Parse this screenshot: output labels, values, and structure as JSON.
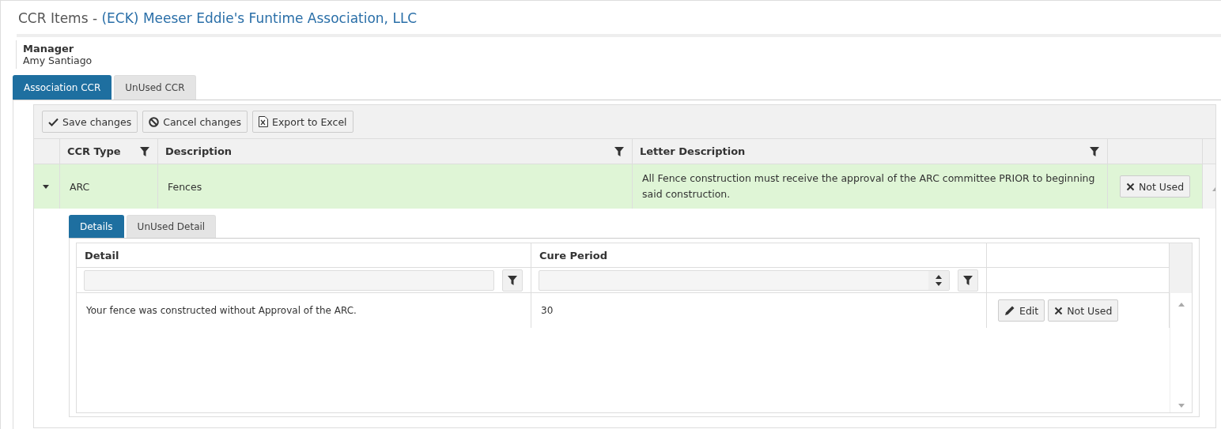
{
  "title": {
    "prefix": "CCR Items - ",
    "association": "(ECK) Meeser Eddie's Funtime Association, LLC"
  },
  "manager": {
    "label": "Manager",
    "name": "Amy Santiago"
  },
  "tabs": [
    {
      "label": "Association CCR",
      "selected": true
    },
    {
      "label": "UnUsed CCR",
      "selected": false
    }
  ],
  "toolbar": [
    {
      "kind": "save",
      "label": "Save changes"
    },
    {
      "kind": "cancel",
      "label": "Cancel changes"
    },
    {
      "kind": "excel",
      "label": "Export to Excel"
    }
  ],
  "table": {
    "columns": [
      {
        "label": "CCR Type"
      },
      {
        "label": "Description"
      },
      {
        "label": "Letter Description"
      }
    ],
    "rows": [
      {
        "expanded": true,
        "cells": [
          "ARC",
          "Fences",
          "All Fence construction must receive the approval of the ARC committee PRIOR to beginning said construction."
        ],
        "action": "Not Used",
        "detail": {
          "tabs": [
            {
              "label": "Details",
              "selected": true
            },
            {
              "label": "UnUsed Detail",
              "selected": false
            }
          ],
          "columns": [
            "Detail",
            "Cure Period"
          ],
          "rows": [
            {
              "cells": [
                "Your fence was constructed without Approval of the ARC.",
                "30"
              ],
              "actions": [
                {
                  "kind": "edit",
                  "label": "Edit"
                },
                {
                  "kind": "remove",
                  "label": "Not Used"
                }
              ]
            }
          ]
        }
      }
    ]
  }
}
